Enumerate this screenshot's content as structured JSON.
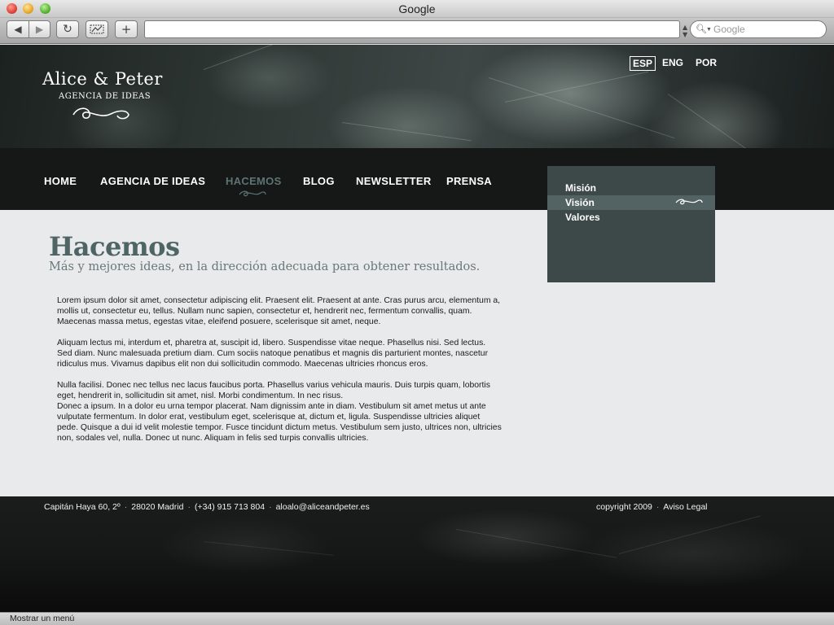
{
  "browser": {
    "window_title": "Google",
    "url": "",
    "search_placeholder": "Google",
    "status_text": "Mostrar un menú"
  },
  "header": {
    "logo_title": "Alice & Peter",
    "logo_subtitle": "AGENCIA DE IDEAS",
    "languages": [
      "ESP",
      "ENG",
      "POR"
    ],
    "active_language": "ESP"
  },
  "nav": {
    "items": [
      "HOME",
      "AGENCIA DE IDEAS",
      "HACEMOS",
      "BLOG",
      "NEWSLETTER",
      "PRENSA"
    ],
    "active": "HACEMOS"
  },
  "submenu": {
    "items": [
      "Misión",
      "Visión",
      "Valores"
    ],
    "active": "Visión"
  },
  "content": {
    "title": "Hacemos",
    "subtitle": "Más y mejores ideas, en la dirección adecuada para obtener resultados.",
    "paragraphs": [
      [
        "Lorem ipsum dolor sit amet, consectetur adipiscing elit. Praesent elit. Praesent at ante. Cras purus arcu, elementum a,",
        "mollis ut, consectetur eu, tellus. Nullam nunc sapien, consectetur et, hendrerit nec, fermentum convallis, quam.",
        "Maecenas massa metus, egestas vitae, eleifend posuere, scelerisque sit amet, neque."
      ],
      [
        "Aliquam lectus mi, interdum et, pharetra at, suscipit id, libero. Suspendisse vitae neque. Phasellus nisi. Sed lectus.",
        "Sed diam. Nunc malesuada pretium diam. Cum sociis natoque penatibus et magnis dis parturient montes, nascetur",
        "ridiculus mus. Vivamus dapibus elit non dui sollicitudin commodo. Maecenas ultricies rhoncus eros."
      ],
      [
        "Nulla facilisi. Donec nec tellus nec lacus faucibus porta. Phasellus varius vehicula mauris. Duis turpis quam, lobortis",
        "eget, hendrerit in, sollicitudin sit amet, nisl. Morbi condimentum. In nec risus.",
        "Donec a ipsum. In a dolor eu urna tempor placerat. Nam dignissim ante in diam. Vestibulum sit amet metus ut ante",
        "vulputate fermentum. In dolor erat, vestibulum eget, scelerisque at, dictum et, ligula. Suspendisse ultricies aliquet",
        "pede. Quisque a dui id velit molestie tempor. Fusce tincidunt dictum metus. Vestibulum sem justo, ultrices non, ultricies",
        "non, sodales vel, nulla. Donec ut nunc. Aliquam in felis sed turpis convallis ultricies."
      ]
    ]
  },
  "footer": {
    "address": "Capitán Haya 60, 2º",
    "postal": "28020 Madrid",
    "phone": "(+34) 915 713 804",
    "email": "aloalo@aliceandpeter.es",
    "copyright": "copyright 2009",
    "legal": "Aviso Legal"
  }
}
